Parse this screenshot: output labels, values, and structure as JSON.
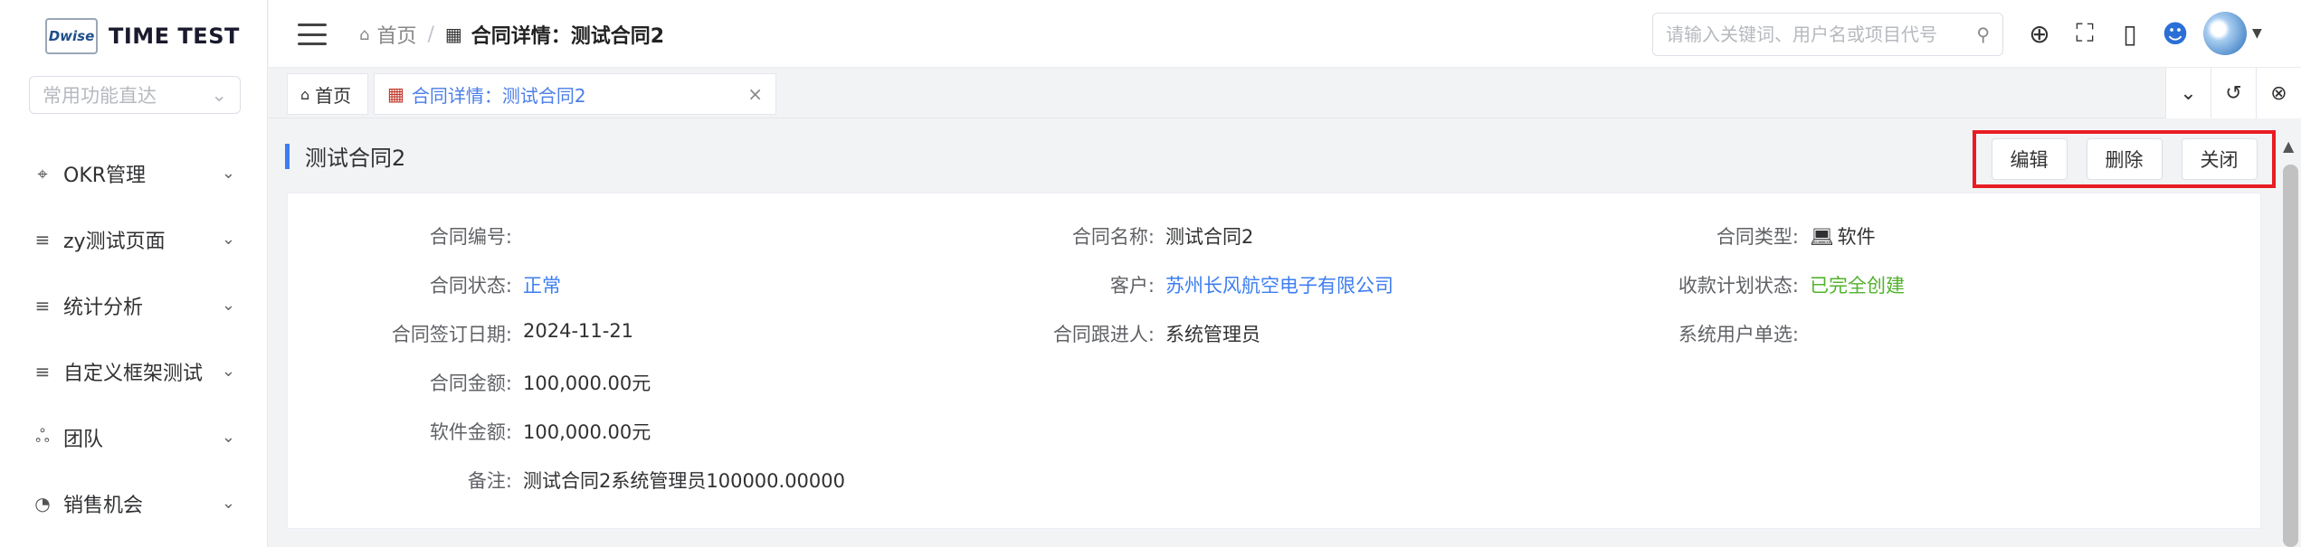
{
  "logo": {
    "mark": "Dwise",
    "name": "TIME TEST"
  },
  "quick_select": {
    "placeholder": "常用功能直达"
  },
  "sidebar": {
    "items": [
      {
        "icon": "target-icon",
        "glyph": "⌖",
        "label": "OKR管理"
      },
      {
        "icon": "list-icon",
        "glyph": "≡",
        "label": "zy测试页面"
      },
      {
        "icon": "list-icon",
        "glyph": "≡",
        "label": "统计分析"
      },
      {
        "icon": "list-icon",
        "glyph": "≡",
        "label": "自定义框架测试"
      },
      {
        "icon": "team-icon",
        "glyph": "ஃ",
        "label": "团队"
      },
      {
        "icon": "pie-chart-icon",
        "glyph": "◔",
        "label": "销售机会"
      }
    ]
  },
  "header": {
    "breadcrumb": {
      "home": "首页",
      "current": "合同详情：测试合同2"
    },
    "search": {
      "placeholder": "请输入关键词、用户名或项目代号"
    }
  },
  "tabs": {
    "home": "首页",
    "active": "合同详情：测试合同2"
  },
  "page": {
    "title": "测试合同2",
    "buttons": {
      "edit": "编辑",
      "delete": "删除",
      "close": "关闭"
    }
  },
  "details": {
    "contract_no": {
      "label": "合同编号:",
      "value": ""
    },
    "contract_name": {
      "label": "合同名称:",
      "value": "测试合同2"
    },
    "contract_type": {
      "label": "合同类型:",
      "value": "软件"
    },
    "contract_status": {
      "label": "合同状态:",
      "value": "正常"
    },
    "customer": {
      "label": "客户:",
      "value": "苏州长风航空电子有限公司"
    },
    "plan_status": {
      "label": "收款计划状态:",
      "value": "已完全创建"
    },
    "sign_date": {
      "label": "合同签订日期:",
      "value": "2024-11-21"
    },
    "follower": {
      "label": "合同跟进人:",
      "value": "系统管理员"
    },
    "user_select": {
      "label": "系统用户单选:",
      "value": ""
    },
    "amount": {
      "label": "合同金额:",
      "value": "100,000.00元"
    },
    "software_amount": {
      "label": "软件金额:",
      "value": "100,000.00元"
    },
    "remark": {
      "label": "备注:",
      "value": "测试合同2系统管理员100000.00000"
    }
  },
  "colors": {
    "accent": "#3c7ef0",
    "highlight": "#e81d24",
    "success": "#52b22e"
  }
}
